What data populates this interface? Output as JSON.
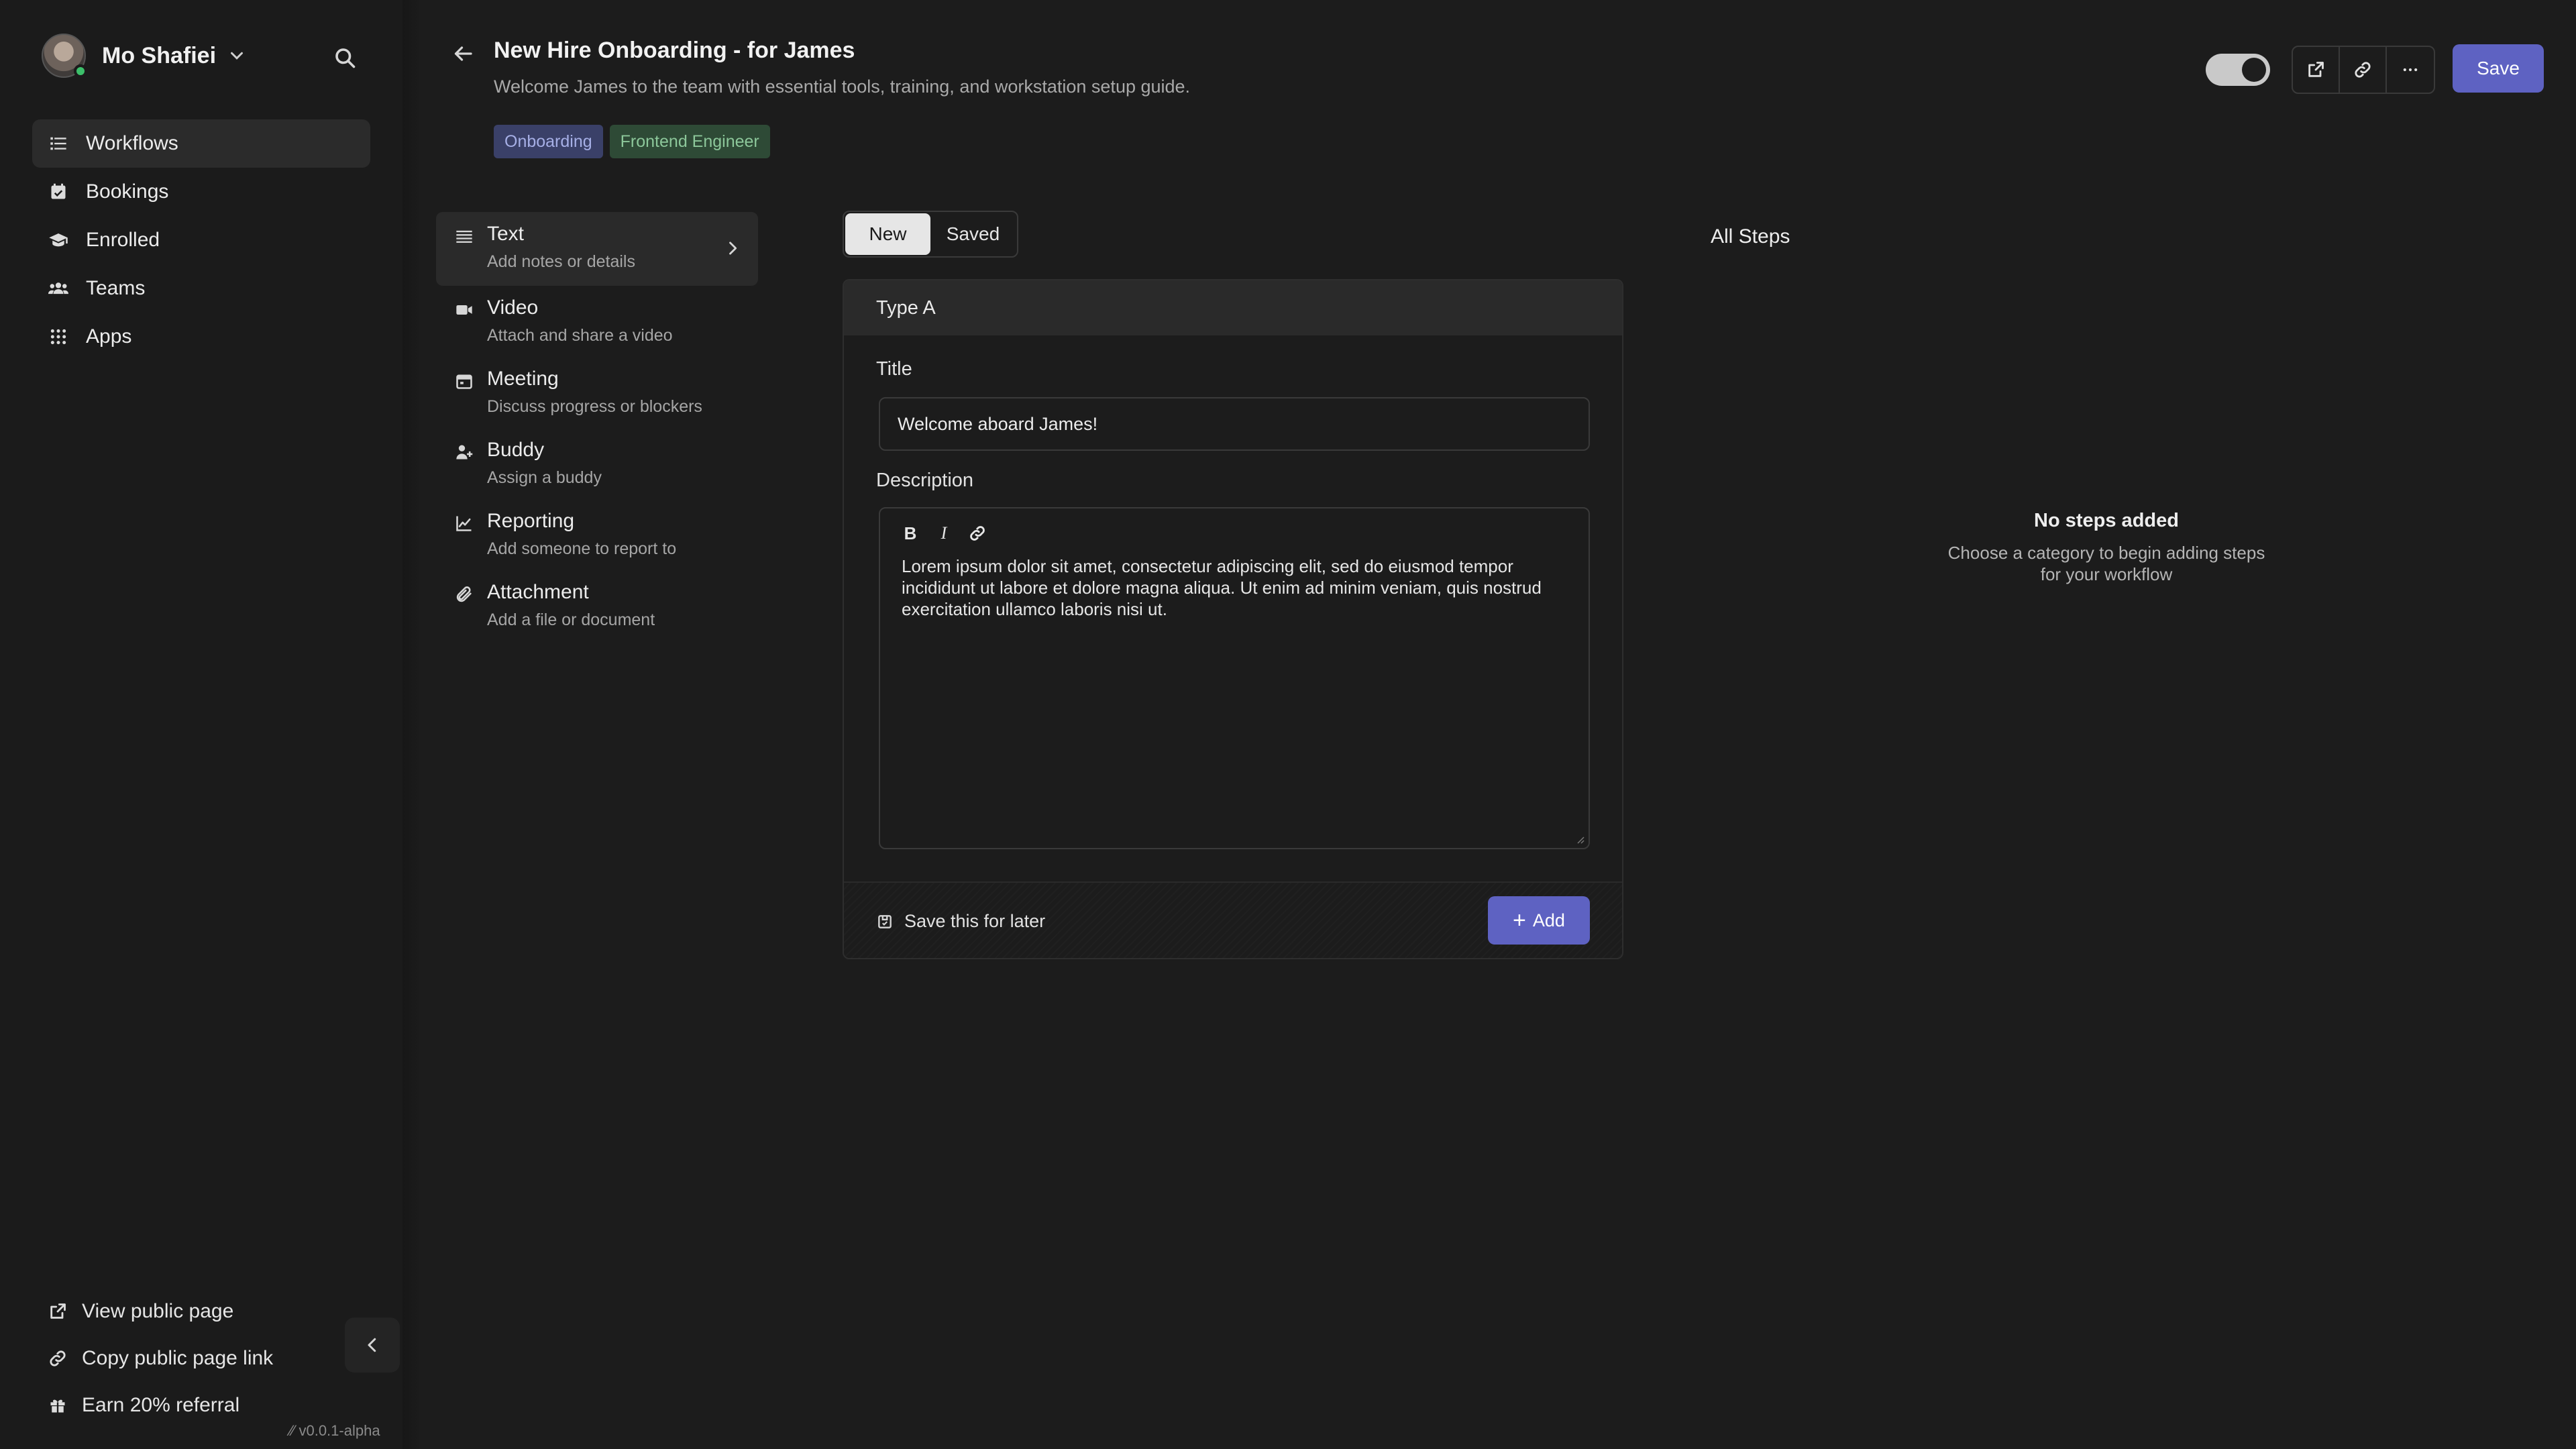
{
  "user": {
    "name": "Mo Shafiei"
  },
  "nav": {
    "items": [
      {
        "label": "Workflows",
        "icon": "list-icon",
        "active": true
      },
      {
        "label": "Bookings",
        "icon": "calendar-check-icon"
      },
      {
        "label": "Enrolled",
        "icon": "graduation-cap-icon"
      },
      {
        "label": "Teams",
        "icon": "users-icon"
      },
      {
        "label": "Apps",
        "icon": "grid-icon"
      }
    ]
  },
  "sidebar_bottom": {
    "view_public": "View public page",
    "copy_link": "Copy public page link",
    "referral": "Earn 20% referral",
    "version": "v0.0.1-alpha"
  },
  "header": {
    "title": "New Hire Onboarding - for James",
    "subtitle": "Welcome James to the team with essential tools, training, and workstation setup guide.",
    "tags": [
      "Onboarding",
      "Frontend Engineer"
    ],
    "save_label": "Save",
    "toggle_on": true
  },
  "categories": [
    {
      "name": "Text",
      "desc": "Add notes or details",
      "icon": "text-lines-icon",
      "active": true
    },
    {
      "name": "Video",
      "desc": "Attach and share a video",
      "icon": "video-icon"
    },
    {
      "name": "Meeting",
      "desc": "Discuss progress or blockers",
      "icon": "calendar-icon"
    },
    {
      "name": "Buddy",
      "desc": "Assign a buddy",
      "icon": "user-plus-icon"
    },
    {
      "name": "Reporting",
      "desc": "Add someone to report to",
      "icon": "chart-icon"
    },
    {
      "name": "Attachment",
      "desc": "Add a file or document",
      "icon": "paperclip-icon"
    }
  ],
  "segment": {
    "new": "New",
    "saved": "Saved",
    "active": "New"
  },
  "form": {
    "card_title": "Type A",
    "title_label": "Title",
    "title_value": "Welcome aboard James!",
    "description_label": "Description",
    "description_value": "Lorem ipsum dolor sit amet, consectetur adipiscing elit, sed do eiusmod tempor incididunt ut labore et dolore magna aliqua. Ut enim ad minim veniam, quis nostrud exercitation ullamco laboris nisi ut.",
    "tools": {
      "bold": "B",
      "italic": "I"
    },
    "save_later": "Save this for later",
    "add_label": "Add"
  },
  "steps": {
    "title": "All Steps",
    "empty_title": "No steps added",
    "empty_desc": "Choose a category to begin adding steps for your workflow"
  },
  "colors": {
    "accent": "#5e62c2",
    "tag_blue_bg": "#3a4068",
    "tag_green_bg": "#2e4a36"
  }
}
